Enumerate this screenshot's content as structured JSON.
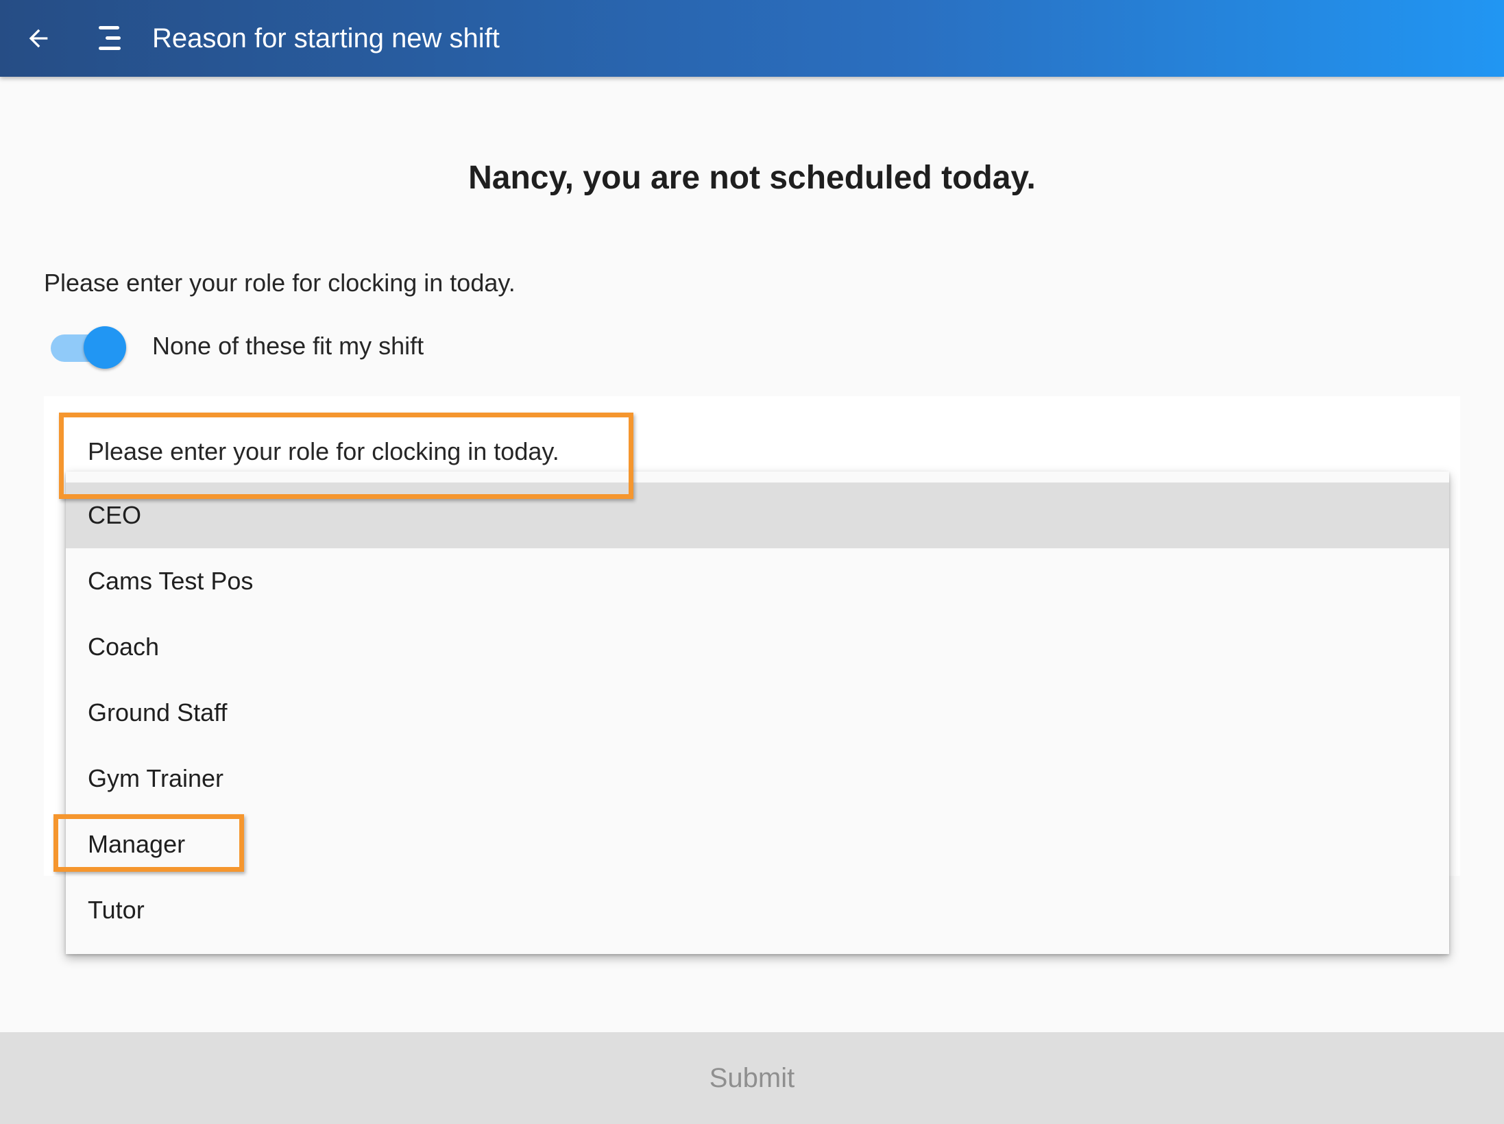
{
  "appbar": {
    "title": "Reason for starting new shift",
    "back_icon": "arrow-left-icon",
    "menu_icon": "menu-icon"
  },
  "main": {
    "heading": "Nancy, you are not scheduled today.",
    "prompt": "Please enter your role for clocking in today.",
    "toggle": {
      "label": "None of these fit my shift",
      "on": true
    },
    "role_field": {
      "label": "Please enter your role for clocking in today."
    },
    "dropdown": {
      "selected": "CEO",
      "options": [
        "CEO",
        "Cams Test Pos",
        "Coach",
        "Ground Staff",
        "Gym Trainer",
        "Manager",
        "Tutor"
      ]
    }
  },
  "submit": {
    "label": "Submit"
  },
  "colors": {
    "appbar_start": "#264d85",
    "appbar_end": "#2196f3",
    "toggle_on": "#2196f3",
    "highlight": "#f5962e",
    "submit_disabled": "#dedede"
  }
}
